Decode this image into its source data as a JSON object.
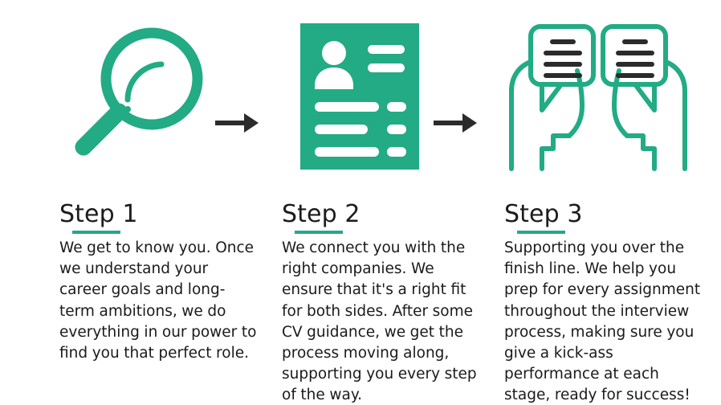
{
  "theme": {
    "accent_green": "#22ab84",
    "arrow_dark": "#2b2b2b",
    "text_dark": "#1a1a1a",
    "background": "#ffffff"
  },
  "steps": [
    {
      "icon": "magnifying-glass-icon",
      "title": "Step 1",
      "body": "We get to know you. Once we understand your career goals and long-term ambitions, we do everything in our power to find you that perfect role."
    },
    {
      "icon": "cv-document-icon",
      "title": "Step 2",
      "body": "We connect you with the right companies. We ensure that it's a right fit for both sides. After some CV guidance, we get the process moving along, supporting you every step of the way."
    },
    {
      "icon": "two-talking-heads-icon",
      "title": "Step 3",
      "body": "Supporting you over the finish line. We help you prep for every assignment throughout the interview process, making sure you give a kick-ass performance at each stage, ready for success!"
    }
  ],
  "connectors": [
    {
      "name": "arrow-step1-to-step2"
    },
    {
      "name": "arrow-step2-to-step3"
    }
  ]
}
